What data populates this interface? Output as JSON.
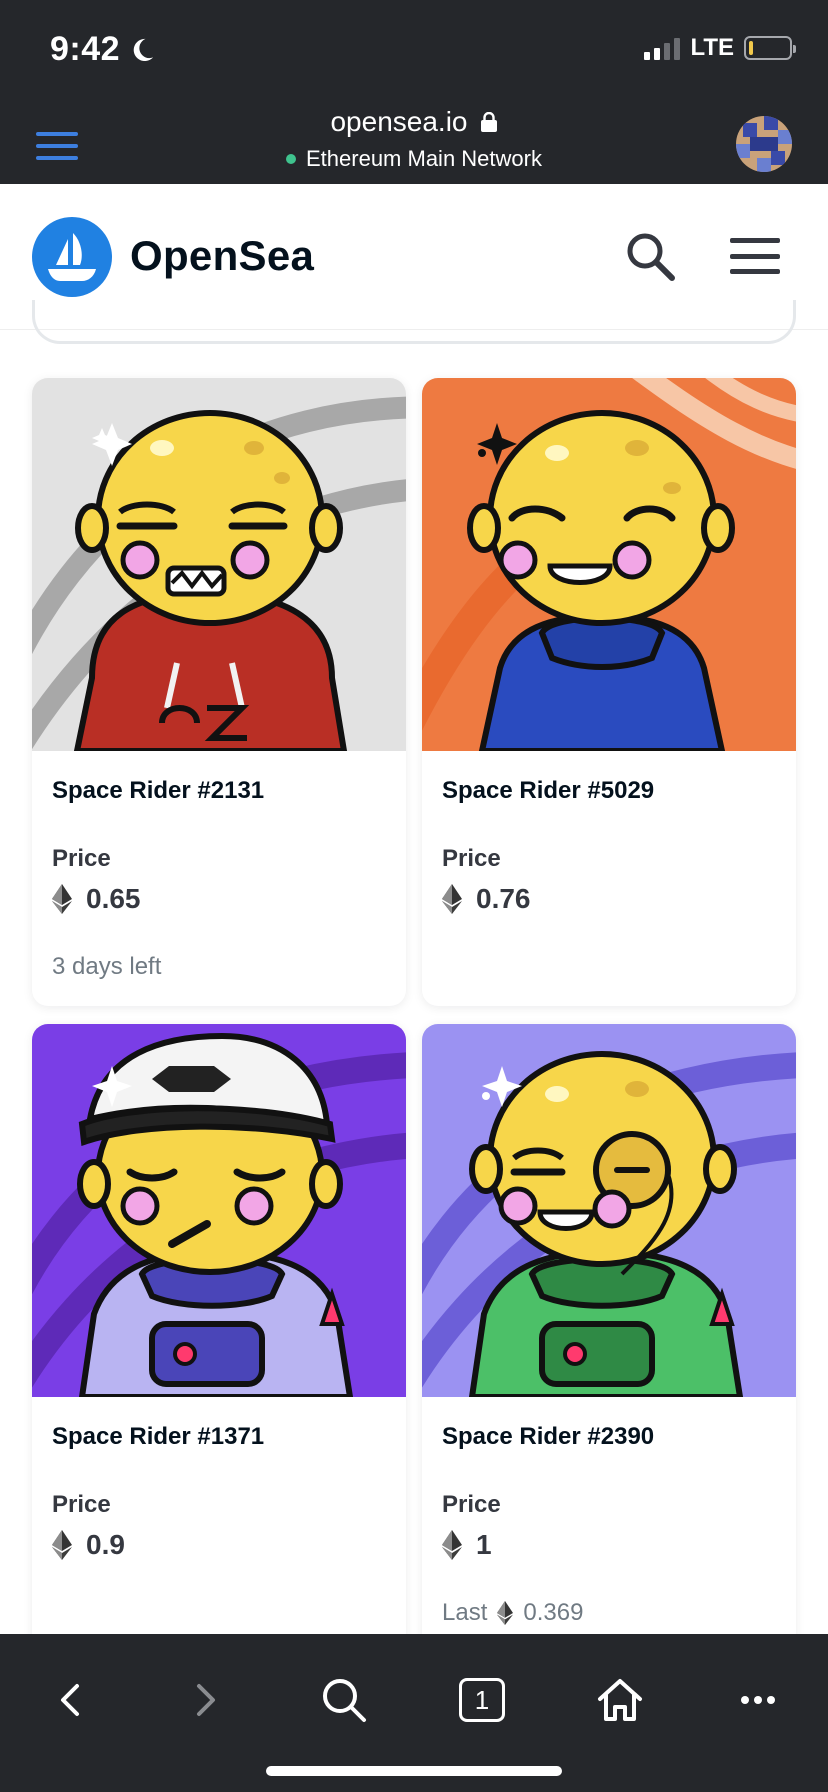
{
  "status_bar": {
    "time": "9:42",
    "carrier": "LTE"
  },
  "browser": {
    "url": "opensea.io",
    "network": "Ethereum Main Network",
    "open_tabs": "1"
  },
  "site": {
    "brand": "OpenSea",
    "brand_color": "#2081e2"
  },
  "listings": [
    {
      "title": "Space Rider #2131",
      "price_label": "Price",
      "price": "0.65",
      "footer": "3 days left",
      "background": "#e0e0e0"
    },
    {
      "title": "Space Rider #5029",
      "price_label": "Price",
      "price": "0.76",
      "footer": "",
      "background": "#ee7a41"
    },
    {
      "title": "Space Rider #1371",
      "price_label": "Price",
      "price": "0.9",
      "footer": "",
      "background": "#7a3ee6"
    },
    {
      "title": "Space Rider #2390",
      "price_label": "Price",
      "price": "1",
      "footer_label": "Last",
      "footer_price": "0.369",
      "background": "#9b92f2"
    }
  ],
  "icons": [
    "moon-icon",
    "signal-icon",
    "battery-icon",
    "menu-icon",
    "lock-icon",
    "search-icon",
    "ethereum-icon",
    "back-icon",
    "forward-icon",
    "home-icon",
    "more-icon"
  ]
}
